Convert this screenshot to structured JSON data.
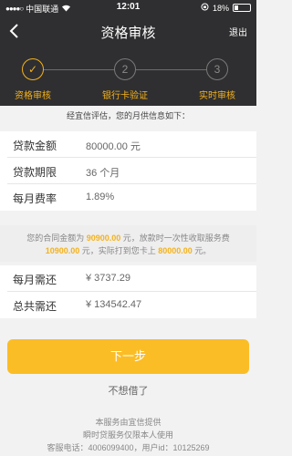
{
  "status_bar": {
    "carrier": "中国联通",
    "time": "12:01",
    "battery": "18%"
  },
  "header": {
    "title": "资格审核",
    "exit_label": "退出"
  },
  "steps": [
    {
      "number": "✓",
      "label": "资格审核",
      "active": true
    },
    {
      "number": "2",
      "label": "银行卡验证",
      "active": false
    },
    {
      "number": "3",
      "label": "实时审核",
      "active": false
    }
  ],
  "intro_text": "经宜信评估，您的月供信息如下：",
  "loan_info": [
    {
      "label": "贷款金额",
      "value": "80000.00 元"
    },
    {
      "label": "贷款期限",
      "value": "36 个月"
    },
    {
      "label": "每月费率",
      "value": "1.89%"
    }
  ],
  "notice": {
    "part1": "您的合同金额为 ",
    "contract_amount": "90900.00",
    "part2": " 元，放款时一次性收取服务费 ",
    "service_fee": "10900.00",
    "part3": " 元，实际打到您卡上 ",
    "actual_amount": "80000.00",
    "part4": " 元。"
  },
  "repayment": [
    {
      "label": "每月需还",
      "value": "¥ 3737.29"
    },
    {
      "label": "总共需还",
      "value": "¥ 134542.47"
    }
  ],
  "buttons": {
    "next": "下一步",
    "decline": "不想借了"
  },
  "footer": {
    "line1": "本服务由宜信提供",
    "line2": "瞬时贷服务仅限本人使用",
    "line3": "客服电话：4006099400，用户id：10125269"
  },
  "colors": {
    "accent": "#fbbd26",
    "dark_bg": "#2f2f31"
  }
}
